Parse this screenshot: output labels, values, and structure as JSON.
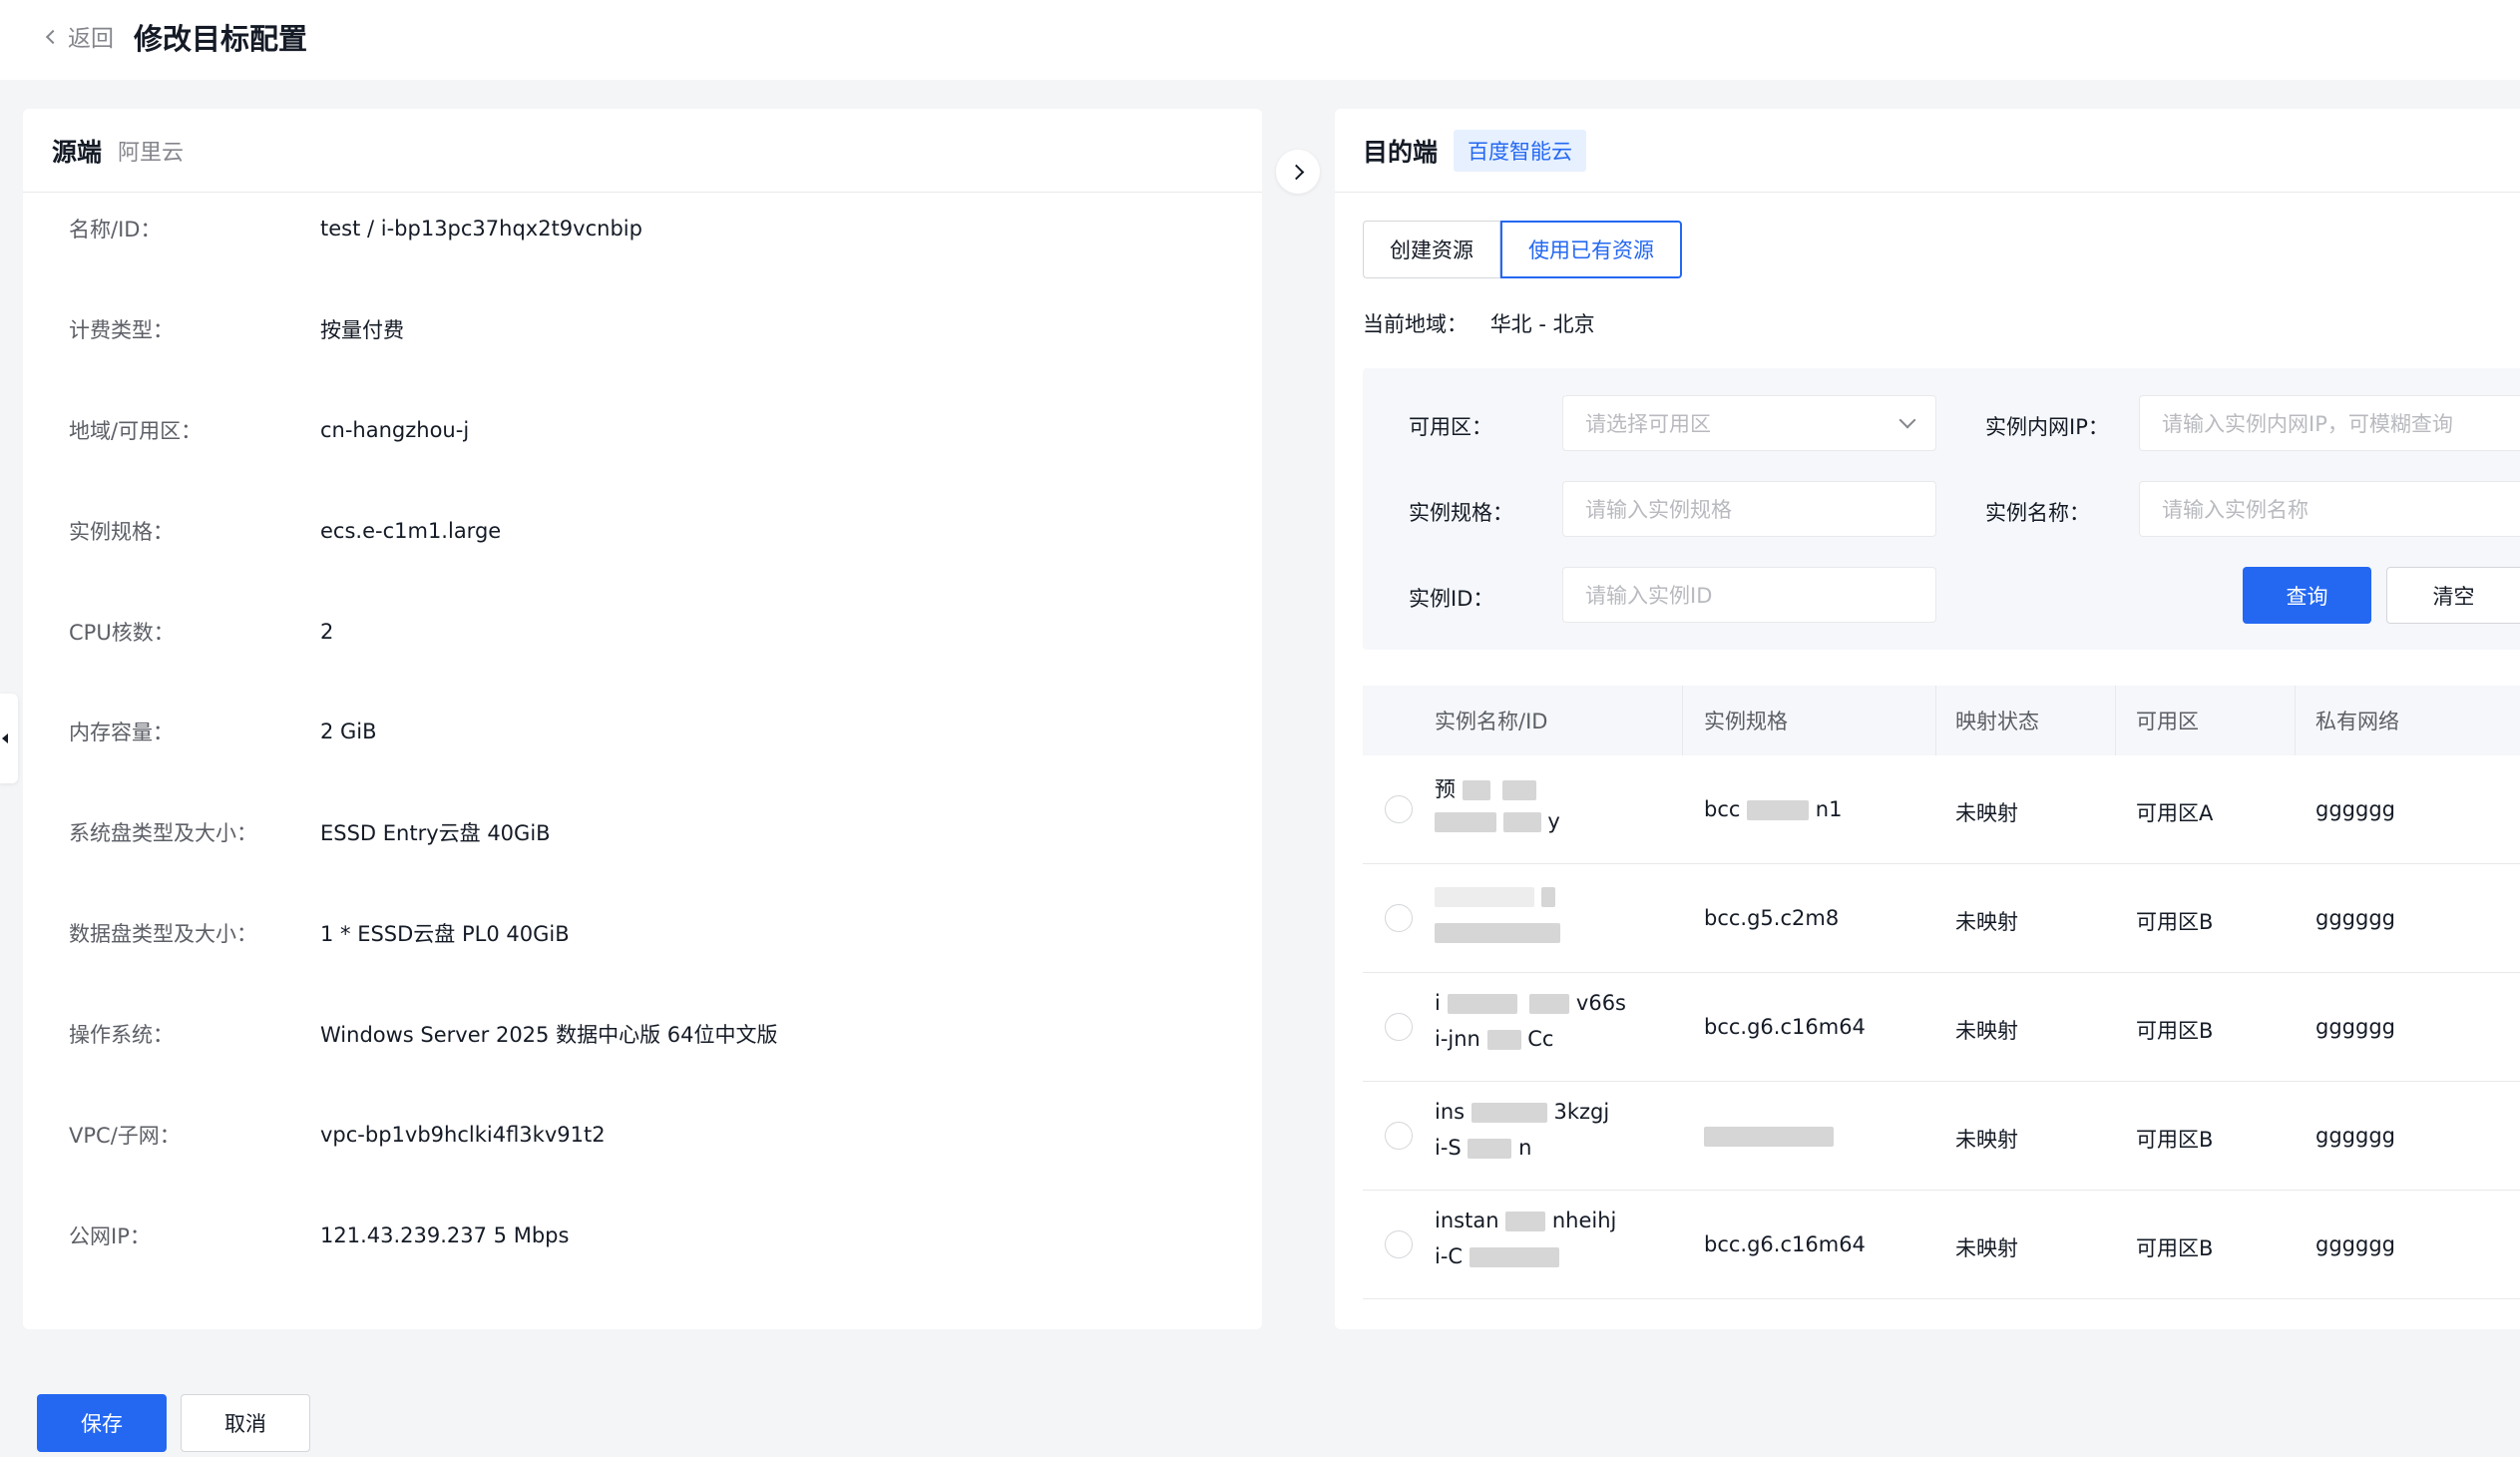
{
  "header": {
    "back_label": "返回",
    "title": "修改目标配置"
  },
  "source": {
    "title": "源端",
    "provider": "阿里云",
    "fields": [
      {
        "label": "名称/ID：",
        "value": "test / i-bp13pc37hqx2t9vcnbip"
      },
      {
        "label": "计费类型：",
        "value": "按量付费"
      },
      {
        "label": "地域/可用区：",
        "value": "cn-hangzhou-j"
      },
      {
        "label": "实例规格：",
        "value": "ecs.e-c1m1.large"
      },
      {
        "label": "CPU核数：",
        "value": "2"
      },
      {
        "label": "内存容量：",
        "value": "2 GiB"
      },
      {
        "label": "系统盘类型及大小：",
        "value": "ESSD Entry云盘 40GiB"
      },
      {
        "label": "数据盘类型及大小：",
        "value": "1 * ESSD云盘 PL0 40GiB"
      },
      {
        "label": "操作系统：",
        "value": "Windows Server 2025 数据中心版 64位中文版"
      },
      {
        "label": "VPC/子网：",
        "value": "vpc-bp1vb9hclki4fl3kv91t2"
      },
      {
        "label": "公网IP：",
        "value": "121.43.239.237 5 Mbps"
      }
    ]
  },
  "target": {
    "title": "目的端",
    "provider": "百度智能云",
    "tabs": [
      "创建资源",
      "使用已有资源"
    ],
    "active_tab": 1,
    "region_label": "当前地域：",
    "region_value": "华北 - 北京",
    "filters": {
      "zone_label": "可用区：",
      "zone_placeholder": "请选择可用区",
      "ip_label": "实例内网IP：",
      "ip_placeholder": "请输入实例内网IP，可模糊查询",
      "spec_label": "实例规格：",
      "spec_placeholder": "请输入实例规格",
      "name_label": "实例名称：",
      "name_placeholder": "请输入实例名称",
      "id_label": "实例ID：",
      "id_placeholder": "请输入实例ID",
      "search_button": "查询",
      "clear_button": "清空"
    },
    "table": {
      "columns": [
        "实例名称/ID",
        "实例规格",
        "映射状态",
        "可用区",
        "私有网络"
      ],
      "rows": [
        {
          "name": "预",
          "name_tail": "",
          "id": "",
          "id_tail": "y",
          "spec": "bcc",
          "spec_tail": "n1",
          "status": "未映射",
          "zone": "可用区A",
          "vpc": "gggggg"
        },
        {
          "name": "",
          "name_tail": "",
          "id": "",
          "id_tail": "",
          "spec": "bcc.g5.c2m8",
          "spec_tail": "",
          "status": "未映射",
          "zone": "可用区B",
          "vpc": "gggggg"
        },
        {
          "name": "i",
          "name_tail": "v66s",
          "id": "i-jnn",
          "id_tail": "Cc",
          "spec": "bcc.g6.c16m64",
          "spec_tail": "",
          "status": "未映射",
          "zone": "可用区B",
          "vpc": "gggggg"
        },
        {
          "name": "ins",
          "name_tail": "3kzgj",
          "id": "i-S",
          "id_tail": "n",
          "spec": "",
          "spec_tail": "",
          "status": "未映射",
          "zone": "可用区B",
          "vpc": "gggggg"
        },
        {
          "name": "instan",
          "name_tail": "nheihj",
          "id": "i-C",
          "id_tail": "",
          "spec": "bcc.g6.c16m64",
          "spec_tail": "",
          "status": "未映射",
          "zone": "可用区B",
          "vpc": "gggggg"
        }
      ]
    }
  },
  "footer": {
    "save_button": "保存",
    "cancel_button": "取消"
  }
}
